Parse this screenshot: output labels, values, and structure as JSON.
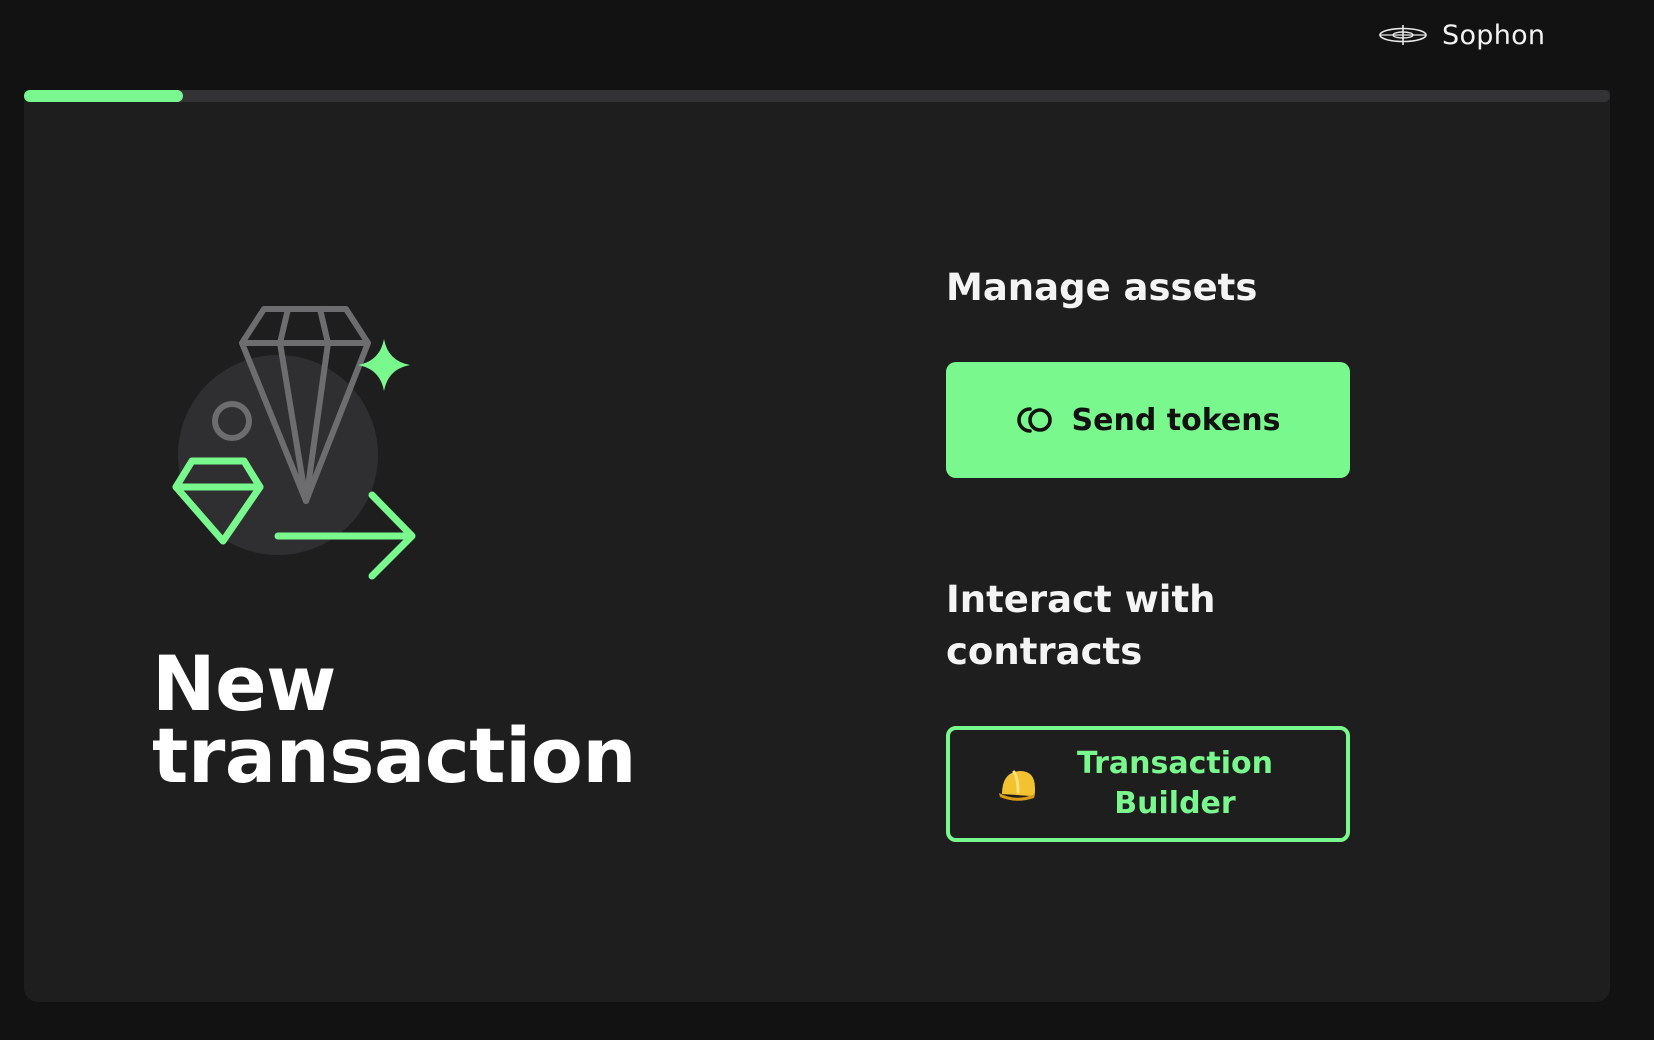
{
  "header": {
    "network_label": "Sophon",
    "network_icon": "sophon-logo-icon"
  },
  "progress": {
    "value_percent": 10
  },
  "main": {
    "title_line1": "New",
    "title_line2": "transaction",
    "illustration_icon": "diamond-transfer-illustration"
  },
  "manage_assets": {
    "heading": "Manage assets",
    "send_tokens_label": "Send tokens",
    "send_tokens_icon": "coins-icon"
  },
  "contracts": {
    "heading": "Interact with contracts",
    "builder_label_line1": "Transaction",
    "builder_label_line2": "Builder",
    "builder_icon": "helmet-icon"
  },
  "colors": {
    "accent": "#79f88d",
    "background": "#121213",
    "panel": "#1e1e1f"
  }
}
